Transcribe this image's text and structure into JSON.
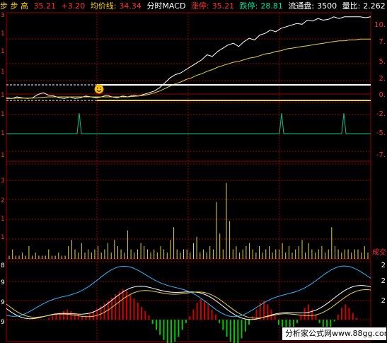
{
  "header": {
    "stock": "步 步 高",
    "price": "35.21",
    "change": "+3.20",
    "avg_label": "均价线:",
    "avg_value": "34.34",
    "indicator": "分时MACD",
    "limit_up_label": "涨停:",
    "limit_up": "35.21",
    "limit_down_label": "跌停:",
    "limit_down": "28.81",
    "float_label": "流通盘:",
    "float_value": "3500",
    "ratio_label": "量比:",
    "ratio_value": "2.262"
  },
  "right_axis": {
    "top": [
      "10.",
      "7.",
      "5.",
      "2.",
      "0.",
      "-2.",
      "-5.",
      "-7."
    ],
    "volume": "成交",
    "macd": [
      "2",
      "2",
      "2"
    ]
  },
  "left_axis": {
    "top": [
      "3",
      "1",
      "1",
      "1",
      "1",
      "1",
      "1",
      "1"
    ],
    "volume": [
      "3",
      "2",
      "1",
      "1"
    ],
    "macd": [
      "8",
      "9",
      "9",
      "9"
    ]
  },
  "footer_text": "分析家公式网www.88gg.com",
  "colors": {
    "price": "#ffffff",
    "avg": "#e6d23c",
    "grid": "#9a0000",
    "volume": "#e6d23c",
    "signal": "#00c890",
    "macd_white": "#ffffff",
    "macd_yellow": "#e6d23c",
    "macd_cyan": "#2ab8ff",
    "macd_up": "#d40000",
    "macd_down": "#00c800",
    "smiley": "#ffcc00"
  },
  "chart_data": [
    {
      "type": "line",
      "series": [
        {
          "values": [
            0.2,
            0.1,
            0.3,
            0.2,
            0.1,
            0.2,
            0.6,
            0.8,
            0.5,
            0.4,
            0.2,
            0.1,
            0.3,
            0.1,
            0.2,
            0.4,
            0.3,
            0.2,
            0.3,
            0.5,
            0.3,
            0.2,
            0.4,
            0.3,
            0.5,
            0.4,
            0.6,
            0.8,
            1.0,
            1.4,
            2.0,
            2.6,
            3.0,
            3.2,
            3.6,
            4.0,
            4.4,
            4.8,
            5.4,
            5.2,
            5.8,
            6.2,
            6.6,
            6.8,
            6.4,
            7.0,
            7.4,
            7.2,
            7.8,
            8.0,
            8.4,
            8.2,
            8.6,
            8.8,
            9.0,
            9.2,
            9.1,
            9.6,
            9.5,
            9.8,
            9.6,
            9.7,
            10.0,
            9.8,
            10.0,
            10.0,
            10.0,
            10.0,
            9.9,
            10.0
          ]
        },
        {
          "values": [
            0.1,
            0.1,
            0.15,
            0.15,
            0.15,
            0.15,
            0.2,
            0.25,
            0.3,
            0.3,
            0.3,
            0.3,
            0.3,
            0.3,
            0.3,
            0.3,
            0.3,
            0.3,
            0.3,
            0.3,
            0.3,
            0.3,
            0.3,
            0.3,
            0.35,
            0.4,
            0.5,
            0.6,
            0.8,
            1.0,
            1.3,
            1.6,
            1.9,
            2.1,
            2.4,
            2.6,
            2.9,
            3.1,
            3.4,
            3.6,
            3.9,
            4.1,
            4.3,
            4.5,
            4.6,
            4.8,
            5.0,
            5.1,
            5.3,
            5.5,
            5.6,
            5.8,
            5.9,
            6.1,
            6.2,
            6.3,
            6.4,
            6.5,
            6.6,
            6.7,
            6.8,
            6.9,
            7.0,
            7.1,
            7.1,
            7.2,
            7.2,
            7.3,
            7.3,
            7.3
          ]
        }
      ],
      "ylim": [
        -7.5,
        10.5
      ]
    },
    {
      "type": "bar",
      "series": [
        {
          "values": [
            1,
            3,
            1,
            1,
            2,
            1,
            4,
            1,
            2,
            1,
            1,
            1,
            3,
            1,
            1,
            2,
            1,
            1,
            4,
            6,
            3,
            2,
            5,
            2,
            3,
            2,
            3,
            4,
            2,
            3,
            5,
            2,
            6,
            4,
            3,
            2,
            9,
            3,
            2,
            3,
            5,
            4,
            3,
            2,
            3,
            2,
            4,
            3,
            2,
            6,
            10,
            3,
            2,
            3,
            3,
            2,
            5,
            7,
            2,
            3,
            2,
            4,
            3,
            18,
            8,
            3,
            24,
            12,
            3,
            4,
            2,
            3,
            4,
            5,
            3,
            2,
            4,
            2,
            3,
            4,
            2,
            3,
            3,
            5,
            2,
            4,
            2,
            3,
            4,
            6,
            2,
            5,
            3,
            2,
            3,
            4,
            2,
            3,
            10,
            4,
            3,
            2,
            3,
            3,
            2,
            3,
            3,
            2,
            4,
            2
          ]
        }
      ],
      "ylim": [
        0,
        30
      ]
    },
    {
      "type": "bar",
      "series": [
        {
          "values": [
            0.2,
            0.4,
            0.6,
            0.8,
            1.0,
            1.2,
            1.0,
            0.8,
            0.6,
            0.4,
            0.5,
            0.7,
            1.0,
            1.3,
            1.6,
            1.9,
            2.2,
            2.6,
            3.0,
            3.3,
            3.6,
            3.4,
            3.0,
            2.5,
            2.0,
            1.5,
            1.0,
            0.5,
            -0.5,
            -1.2,
            -1.8,
            -2.4,
            -2.8,
            -3.0,
            -2.6,
            -2.0,
            -1.2,
            -0.4,
            0.4,
            1.2,
            2.0,
            2.4,
            2.2,
            1.8,
            1.2,
            0.6,
            -0.4,
            -1.2,
            -2.0,
            -2.6,
            -3.0,
            -2.8,
            -2.2,
            -1.4,
            -0.6,
            0.4,
            1.2,
            2.0,
            2.2,
            1.8,
            1.2,
            0.4,
            -0.6,
            -1.6,
            -2.4,
            -2.0,
            -1.2,
            -0.4,
            0.6,
            1.4,
            1.8,
            1.2,
            0.6,
            -0.4,
            -1.2,
            -1.6,
            -1.0,
            -0.2,
            0.6,
            1.4,
            1.8,
            1.4,
            0.8,
            0.2
          ]
        }
      ]
    }
  ]
}
